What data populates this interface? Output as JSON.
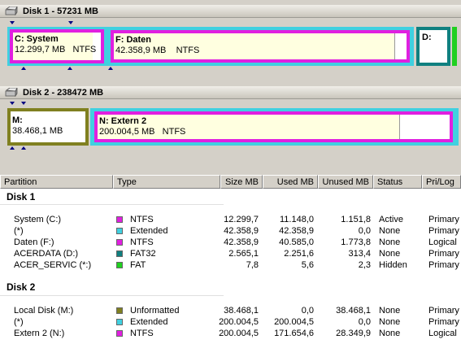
{
  "disk1": {
    "title": "Disk 1 - 57231 MB",
    "partitions": [
      {
        "name": "C:  System",
        "size": "12.299,7 MB",
        "fs": "NTFS",
        "border": "#e020e0",
        "used_fraction": 0.91
      },
      {
        "name": "F:  Daten",
        "size": "42.358,9 MB",
        "fs": "NTFS",
        "border": "#e020e0",
        "used_fraction": 0.96
      },
      {
        "name": "D:",
        "border": "#108080"
      }
    ]
  },
  "disk2": {
    "title": "Disk 2 - 238472 MB",
    "partitions": [
      {
        "name": "M:",
        "size": "38.468,1 MB",
        "border": "#808020",
        "used_fraction": 0
      },
      {
        "name": "N:  Extern 2",
        "size": "200.004,5 MB",
        "fs": "NTFS",
        "border": "#e020e0",
        "used_fraction": 0.86
      }
    ]
  },
  "table": {
    "columns": [
      "Partition",
      "Type",
      "Size MB",
      "Used MB",
      "Unused MB",
      "Status",
      "Pri/Log"
    ],
    "groups": [
      {
        "title": "Disk 1",
        "rows": [
          {
            "partition": "System (C:)",
            "color": "#e020e0",
            "type": "NTFS",
            "size": "12.299,7",
            "used": "11.148,0",
            "unused": "1.151,8",
            "status": "Active",
            "prilog": "Primary"
          },
          {
            "partition": "(*)",
            "color": "#40d0e0",
            "type": "Extended",
            "size": "42.358,9",
            "used": "42.358,9",
            "unused": "0,0",
            "status": "None",
            "prilog": "Primary"
          },
          {
            "partition": "Daten (F:)",
            "color": "#e020e0",
            "type": "NTFS",
            "size": "42.358,9",
            "used": "40.585,0",
            "unused": "1.773,8",
            "status": "None",
            "prilog": "Logical"
          },
          {
            "partition": "ACERDATA (D:)",
            "color": "#108080",
            "type": "FAT32",
            "size": "2.565,1",
            "used": "2.251,6",
            "unused": "313,4",
            "status": "None",
            "prilog": "Primary"
          },
          {
            "partition": "ACER_SERVIC (*:)",
            "color": "#20d020",
            "type": "FAT",
            "size": "7,8",
            "used": "5,6",
            "unused": "2,3",
            "status": "Hidden",
            "prilog": "Primary"
          }
        ]
      },
      {
        "title": "Disk 2",
        "rows": [
          {
            "partition": "Local Disk (M:)",
            "color": "#808020",
            "type": "Unformatted",
            "size": "38.468,1",
            "used": "0,0",
            "unused": "38.468,1",
            "status": "None",
            "prilog": "Primary"
          },
          {
            "partition": "(*)",
            "color": "#40d0e0",
            "type": "Extended",
            "size": "200.004,5",
            "used": "200.004,5",
            "unused": "0,0",
            "status": "None",
            "prilog": "Primary"
          },
          {
            "partition": "Extern 2 (N:)",
            "color": "#e020e0",
            "type": "NTFS",
            "size": "200.004,5",
            "used": "171.654,6",
            "unused": "28.349,9",
            "status": "None",
            "prilog": "Logical"
          }
        ]
      }
    ]
  }
}
